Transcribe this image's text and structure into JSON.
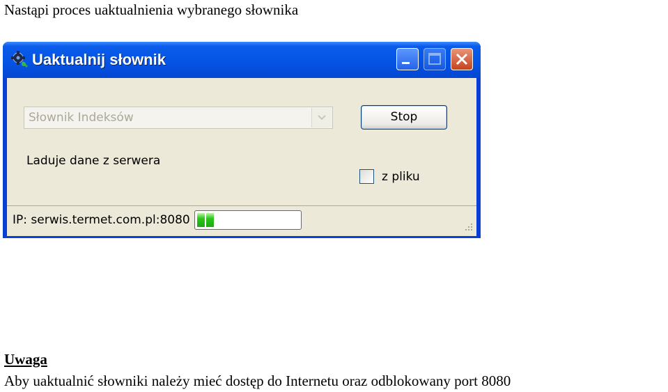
{
  "document": {
    "heading": "Nastąpi proces uaktualnienia wybranego słownika",
    "note_title": "Uwaga",
    "note_text": "Aby uaktualnić słowniki należy mieć dostęp do Internetu oraz odblokowany port 8080"
  },
  "window": {
    "title": "Uaktualnij słownik",
    "title_icon": "gear-icon",
    "controls": [
      "minimize",
      "maximize",
      "close"
    ]
  },
  "form": {
    "dictionary_select": {
      "value": "Słownik Indeksów",
      "disabled": true
    },
    "stop_label": "Stop",
    "status_text": "Laduje dane z serwera",
    "from_file_label": "z pliku",
    "from_file_checked": false
  },
  "statusbar": {
    "ip_text": "IP: serwis.termet.com.pl:8080",
    "progress_percent": 14
  },
  "colors": {
    "titlebar": "#0554E4",
    "client": "#ECE9D8",
    "progress": "#2BC41A",
    "close_button": "#C5431E"
  }
}
